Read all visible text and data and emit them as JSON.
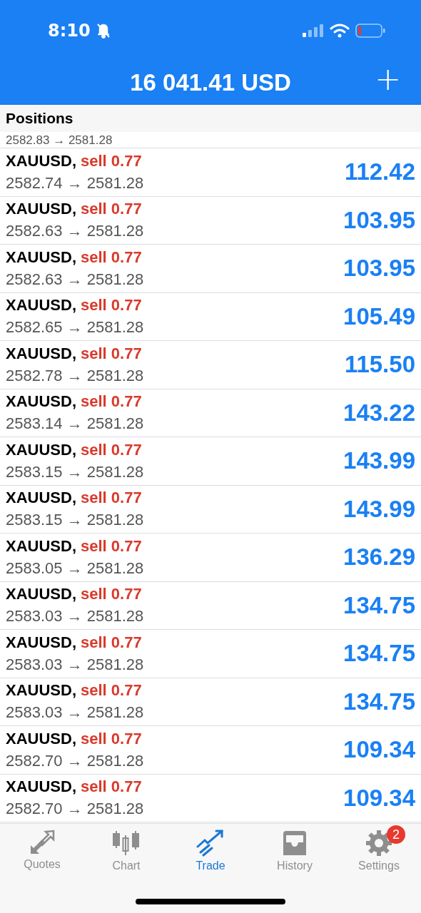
{
  "status_bar": {
    "time": "8:10"
  },
  "header": {
    "title": "16 041.41 USD",
    "add_button": "+"
  },
  "section": {
    "title": "Positions"
  },
  "partial_row": {
    "prices": "2582.83 → 2581.28"
  },
  "positions": [
    {
      "symbol": "XAUUSD,",
      "side": "sell 0.77",
      "prices": "2582.74 → 2581.28",
      "profit": "112.42"
    },
    {
      "symbol": "XAUUSD,",
      "side": "sell 0.77",
      "prices": "2582.63 → 2581.28",
      "profit": "103.95"
    },
    {
      "symbol": "XAUUSD,",
      "side": "sell 0.77",
      "prices": "2582.63 → 2581.28",
      "profit": "103.95"
    },
    {
      "symbol": "XAUUSD,",
      "side": "sell 0.77",
      "prices": "2582.65 → 2581.28",
      "profit": "105.49"
    },
    {
      "symbol": "XAUUSD,",
      "side": "sell 0.77",
      "prices": "2582.78 → 2581.28",
      "profit": "115.50"
    },
    {
      "symbol": "XAUUSD,",
      "side": "sell 0.77",
      "prices": "2583.14 → 2581.28",
      "profit": "143.22"
    },
    {
      "symbol": "XAUUSD,",
      "side": "sell 0.77",
      "prices": "2583.15 → 2581.28",
      "profit": "143.99"
    },
    {
      "symbol": "XAUUSD,",
      "side": "sell 0.77",
      "prices": "2583.15 → 2581.28",
      "profit": "143.99"
    },
    {
      "symbol": "XAUUSD,",
      "side": "sell 0.77",
      "prices": "2583.05 → 2581.28",
      "profit": "136.29"
    },
    {
      "symbol": "XAUUSD,",
      "side": "sell 0.77",
      "prices": "2583.03 → 2581.28",
      "profit": "134.75"
    },
    {
      "symbol": "XAUUSD,",
      "side": "sell 0.77",
      "prices": "2583.03 → 2581.28",
      "profit": "134.75"
    },
    {
      "symbol": "XAUUSD,",
      "side": "sell 0.77",
      "prices": "2583.03 → 2581.28",
      "profit": "134.75"
    },
    {
      "symbol": "XAUUSD,",
      "side": "sell 0.77",
      "prices": "2582.70 → 2581.28",
      "profit": "109.34"
    },
    {
      "symbol": "XAUUSD,",
      "side": "sell 0.77",
      "prices": "2582.70 → 2581.28",
      "profit": "109.34"
    }
  ],
  "tabs": [
    {
      "kind": "quotes",
      "label": "Quotes",
      "selected": false
    },
    {
      "kind": "chart",
      "label": "Chart",
      "selected": false
    },
    {
      "kind": "trade",
      "label": "Trade",
      "selected": true
    },
    {
      "kind": "history",
      "label": "History",
      "selected": false
    },
    {
      "kind": "settings",
      "label": "Settings",
      "selected": false,
      "badge": "2"
    }
  ]
}
